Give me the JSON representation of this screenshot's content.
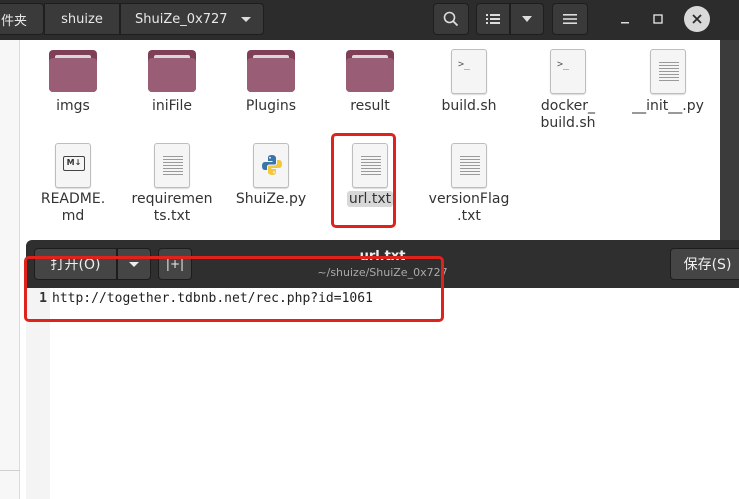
{
  "file_manager": {
    "breadcrumbs": [
      "件夹",
      "shuize",
      "ShuiZe_0x727"
    ],
    "items": [
      {
        "name": "imgs",
        "type": "folder"
      },
      {
        "name": "iniFile",
        "type": "folder"
      },
      {
        "name": "Plugins",
        "type": "folder"
      },
      {
        "name": "result",
        "type": "folder"
      },
      {
        "name": "build.sh",
        "type": "script"
      },
      {
        "name_lines": [
          "docker_",
          "build.sh"
        ],
        "type": "script"
      },
      {
        "name": "__init__.py",
        "type": "text"
      },
      {
        "name_lines": [
          "README.",
          "md"
        ],
        "type": "markdown",
        "badge": "M↓"
      },
      {
        "name_lines": [
          "requiremen",
          "ts.txt"
        ],
        "type": "text"
      },
      {
        "name": "ShuiZe.py",
        "type": "python"
      },
      {
        "name": "url.txt",
        "type": "text",
        "selected": true
      },
      {
        "name_lines": [
          "versionFlag",
          ".txt"
        ],
        "type": "text"
      }
    ]
  },
  "editor": {
    "title": "url.txt",
    "subtitle": "~/shuize/ShuiZe_0x727",
    "open_label": "打开(O)",
    "newtab_label": "|+|",
    "save_label": "保存(S)",
    "lines": [
      {
        "number": "1",
        "text": "http://together.tdbnb.net/rec.php?id=1061"
      }
    ]
  },
  "colors": {
    "folder": "#9a5d76",
    "highlight_box": "#e0221d",
    "header_dark": "#2c2c2c"
  },
  "icons": [
    "search-icon",
    "list-view-icon",
    "chevron-down-icon",
    "hamburger-menu-icon",
    "minimize-icon",
    "maximize-icon",
    "close-icon",
    "folder-icon",
    "script-file-icon",
    "text-file-icon",
    "markdown-file-icon",
    "python-file-icon"
  ]
}
